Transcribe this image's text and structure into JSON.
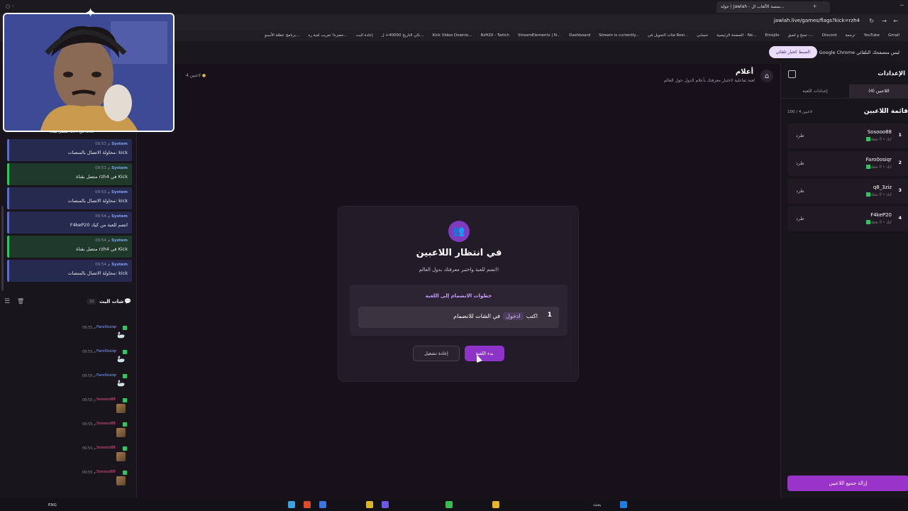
{
  "browser": {
    "active_tab_title": "جولة | Jawlah - منصة الألعاب ال...",
    "tabs_count_hint": "",
    "url": "jawlah.live/games/flags?kick=rzh4",
    "bookmarks": [
      "Gmail",
      "YouTube",
      "ترجمة",
      "Discord",
      "تسخ و لصق -...",
      "Emojilo",
      "الصفحة الرئيسية - Ne...",
      "حسابي",
      "فئات التحويل في Resi...",
      "Stream is currently...",
      "Dashboard",
      "StreamElements | N...",
      "RzH20 - Twitch",
      "Kick Video Downlo...",
      "نكي التاريخ 40000+ ل...",
      "إعادة البث",
      "حضرة! تعريب لعبة ره...",
      "برنامج عطلة الأسبو..."
    ],
    "infobar": {
      "text": "Google Chrome ليس متصفحك التلقائي",
      "button": "الضبط كخيار تلقائي"
    }
  },
  "left_panel": {
    "top_partial_msg": "متصل بقناة rzh4 في Kick",
    "messages": [
      {
        "type": "blue",
        "user": "System",
        "time": "09:53 م",
        "text": "محاولة الاتصال بالمنصات: kick"
      },
      {
        "type": "green",
        "user": "System",
        "time": "09:53 م",
        "text": "متصل بقناة rzh4 في Kick"
      },
      {
        "type": "blue",
        "user": "System",
        "time": "09:53 م",
        "text": "محاولة الاتصال بالمنصات: kick"
      },
      {
        "type": "blue",
        "user": "System",
        "time": "09:54 م",
        "text": "F4keP20 انضم للعبة من كيك"
      },
      {
        "type": "green",
        "user": "System",
        "time": "09:54 م",
        "text": "متصل بقناة rzh4 في Kick"
      },
      {
        "type": "blue",
        "user": "System",
        "time": "09:54 م",
        "text": "محاولة الاتصال بالمنصات: kick"
      }
    ],
    "chat_header": {
      "title": "شات البث",
      "count": "10"
    },
    "chat_messages": [
      {
        "user": "Faro0osiqr",
        "time": "09:55 م",
        "color": "#7fa0ff",
        "kind": "goose"
      },
      {
        "user": "Faro0osiqr",
        "time": "09:55 م",
        "color": "#7fa0ff",
        "kind": "goose"
      },
      {
        "user": "Faro0osiqr",
        "time": "09:55 م",
        "color": "#7fa0ff",
        "kind": "goose"
      },
      {
        "user": "Sosooo88",
        "time": "09:55 م",
        "color": "#e85a8a",
        "kind": "avatar"
      },
      {
        "user": "Sosooo88",
        "time": "09:55 م",
        "color": "#e85a8a",
        "kind": "avatar"
      },
      {
        "user": "Sosooo88",
        "time": "09:55 م",
        "color": "#e85a8a",
        "kind": "avatar"
      },
      {
        "user": "Sosooo88",
        "time": "09:55 م",
        "color": "#e85a8a",
        "kind": "avatar"
      }
    ]
  },
  "center": {
    "title": "أعلام",
    "subtitle": "لعبة تفاعلية لاختبار معرفتك بأعلام الدول حول العالم",
    "players_count": "4 لاعبين",
    "card": {
      "title": "في انتظار اللاعبين",
      "subtitle": "انضم للعبة واختبر معرفتك بدول العالم!",
      "steps_title": "خطوات الانضمام إلى اللعبة",
      "step_number": "1",
      "step_prefix": "اكتب",
      "step_code": "ادخول",
      "step_suffix": "في الشات للانضمام",
      "restart_label": "إعادة تشغيل",
      "start_label": "بدء اللعبة"
    }
  },
  "right_panel": {
    "title": "الإعدادات",
    "tab_players": "اللاعبين (4)",
    "tab_settings": "إعدادات اللعبة",
    "list_title": "قائمة اللاعبين",
    "list_count": "100 / 4 لاعبين",
    "players": [
      {
        "index": "1",
        "name": "Sosooo88",
        "meta": "كيك • 0 نقطة",
        "kick": "طرد"
      },
      {
        "index": "2",
        "name": "Faro0osiqr",
        "meta": "كيك • 0 نقطة",
        "kick": "طرد"
      },
      {
        "index": "3",
        "name": "q8_3ziz",
        "meta": "كيك • 0 نقطة",
        "kick": "طرد"
      },
      {
        "index": "4",
        "name": "F4keP20",
        "meta": "كيك • 0 نقطة",
        "kick": "طرد"
      }
    ],
    "remove_all": "إزالة جميع اللاعبين"
  },
  "taskbar": {
    "lang": "ENG",
    "search": "بحث"
  },
  "colors": {
    "accent": "#8d33c7",
    "kick_green": "#29c860",
    "system_blue": "#5c6fc7"
  }
}
